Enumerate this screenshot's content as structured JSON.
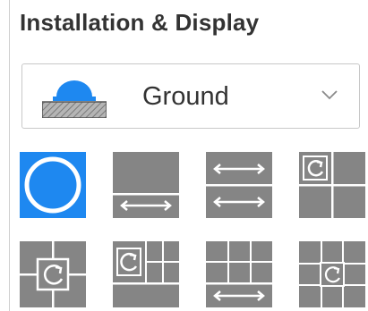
{
  "panel": {
    "title": "Installation & Display"
  },
  "mount_select": {
    "selected_label": "Ground",
    "icon": "ground-mount-icon"
  },
  "colors": {
    "selected_tile": "#1e88f0",
    "tile": "#858585",
    "mount_dome": "#1e88f0"
  },
  "display_modes": [
    {
      "icon": "fisheye-mode-icon",
      "selected": true
    },
    {
      "icon": "panorama-1-icon",
      "selected": false
    },
    {
      "icon": "panorama-2-icon",
      "selected": false
    },
    {
      "icon": "fisheye-plus-3-icon",
      "selected": false
    },
    {
      "icon": "fisheye-plus-4-icon",
      "selected": false
    },
    {
      "icon": "fisheye-plus-6-icon",
      "selected": false
    },
    {
      "icon": "panorama-plus-6-icon",
      "selected": false
    },
    {
      "icon": "fisheye-plus-8-icon",
      "selected": false
    }
  ]
}
